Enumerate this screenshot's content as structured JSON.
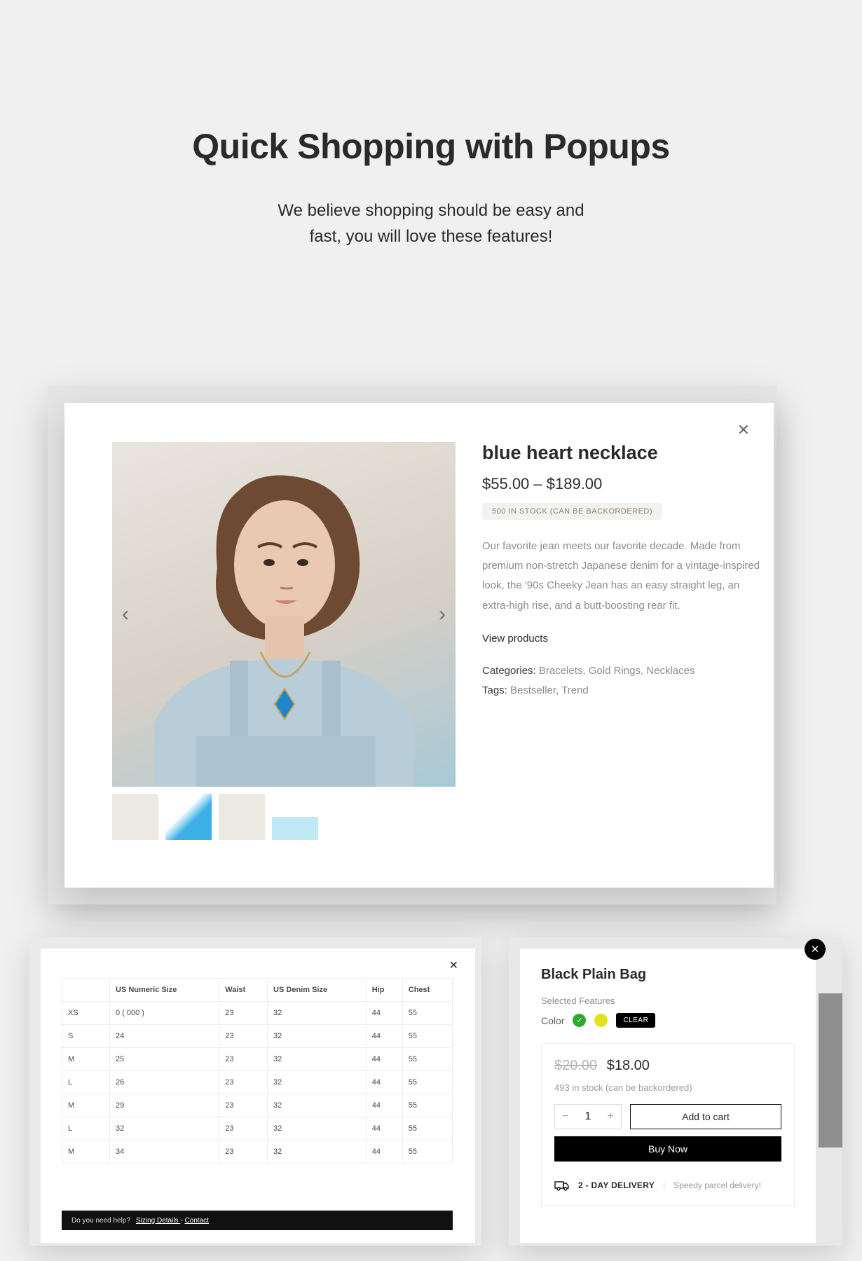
{
  "header": {
    "title": "Quick Shopping with Popups",
    "subtitle_line1": "We believe shopping should be easy and",
    "subtitle_line2": "fast, you will love these features!"
  },
  "quickview": {
    "close": "✕",
    "arrows": {
      "left": "‹",
      "right": "›"
    },
    "name": "blue heart necklace",
    "price": "$55.00 – $189.00",
    "stock_badge": "500 IN STOCK (CAN BE BACKORDERED)",
    "description": "Our favorite jean meets our favorite decade. Made from premium non-stretch Japanese denim for a vintage-inspired look, the '90s Cheeky Jean has an easy straight leg, an extra-high rise, and a butt-boosting rear fit.",
    "view_products": "View products",
    "categories_label": "Categories: ",
    "categories": "Bracelets, Gold Rings, Necklaces",
    "tags_label": "Tags: ",
    "tags": "Bestseller, Trend"
  },
  "sizechart": {
    "close": "✕",
    "headers": [
      "",
      "US Numeric Size",
      "Waist",
      "US Denim Size",
      "Hip",
      "Chest"
    ],
    "rows": [
      [
        "XS",
        "0 ( 000 )",
        "23",
        "32",
        "44",
        "55"
      ],
      [
        "S",
        "24",
        "23",
        "32",
        "44",
        "55"
      ],
      [
        "M",
        "25",
        "23",
        "32",
        "44",
        "55"
      ],
      [
        "L",
        "26",
        "23",
        "32",
        "44",
        "55"
      ],
      [
        "M",
        "29",
        "23",
        "32",
        "44",
        "55"
      ],
      [
        "L",
        "32",
        "23",
        "32",
        "44",
        "55"
      ],
      [
        "M",
        "34",
        "23",
        "32",
        "44",
        "55"
      ]
    ],
    "footer": {
      "help": "Do you need help?",
      "link1": "Sizing Details ",
      "dash": "- ",
      "link2": "Contact"
    }
  },
  "cart": {
    "close": "✕",
    "title": "Black Plain Bag",
    "selected_features": "Selected Features",
    "color_label": "Color",
    "swatch_check": "✓",
    "clear": "CLEAR",
    "old_price": "$20.00",
    "price": "$18.00",
    "stock": "493 in stock (can be backordered)",
    "qty": {
      "minus": "−",
      "value": "1",
      "plus": "+"
    },
    "add_to_cart": "Add to cart",
    "buy_now": "Buy Now",
    "delivery_label": "2 - DAY DELIVERY",
    "delivery_sep": "|",
    "delivery_note": "Speedy parcel delivery!"
  }
}
